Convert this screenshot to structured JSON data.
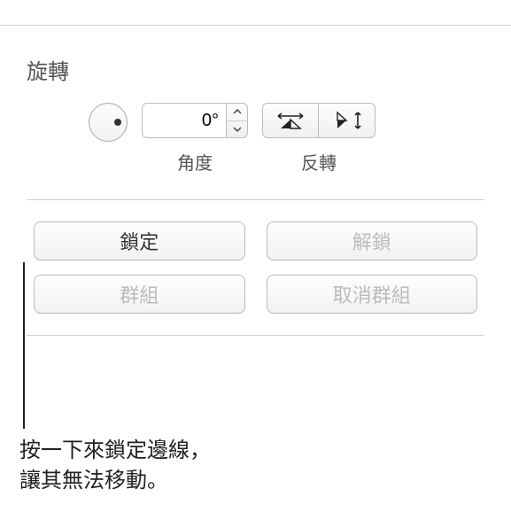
{
  "rotate": {
    "title": "旋轉",
    "angle_value": "0°",
    "angle_label": "角度",
    "flip_label": "反轉"
  },
  "buttons": {
    "lock": "鎖定",
    "unlock": "解鎖",
    "group": "群組",
    "ungroup": "取消群組"
  },
  "callout": {
    "line1": "按一下來鎖定邊線，",
    "line2": "讓其無法移動。"
  }
}
